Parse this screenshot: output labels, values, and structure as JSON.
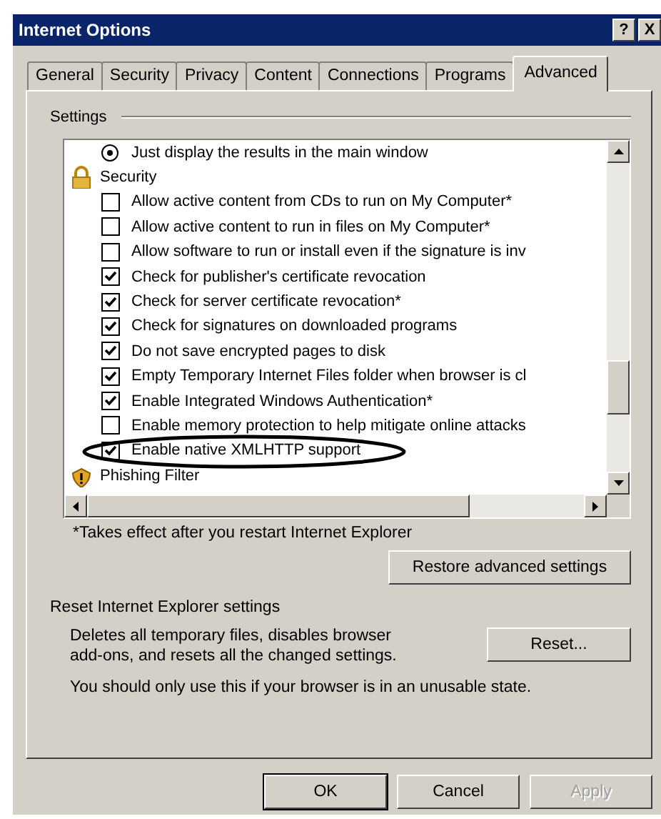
{
  "window": {
    "title": "Internet Options",
    "help_glyph": "?",
    "close_glyph": "X"
  },
  "tabs": [
    {
      "label": "General",
      "selected": false
    },
    {
      "label": "Security",
      "selected": false
    },
    {
      "label": "Privacy",
      "selected": false
    },
    {
      "label": "Content",
      "selected": false
    },
    {
      "label": "Connections",
      "selected": false
    },
    {
      "label": "Programs",
      "selected": false
    },
    {
      "label": "Advanced",
      "selected": true
    }
  ],
  "settings": {
    "label": "Settings",
    "items": [
      {
        "kind": "radio",
        "label": "Just display the results in the main window",
        "checked": true,
        "annotated": false
      },
      {
        "kind": "lock_category",
        "label": "Security"
      },
      {
        "kind": "checkbox",
        "label": "Allow active content from CDs to run on My Computer*",
        "checked": false,
        "annotated": false
      },
      {
        "kind": "checkbox",
        "label": "Allow active content to run in files on My Computer*",
        "checked": false,
        "annotated": false
      },
      {
        "kind": "checkbox",
        "label": "Allow software to run or install even if the signature is inv",
        "checked": false,
        "annotated": false
      },
      {
        "kind": "checkbox",
        "label": "Check for publisher's certificate revocation",
        "checked": true,
        "annotated": false
      },
      {
        "kind": "checkbox",
        "label": "Check for server certificate revocation*",
        "checked": true,
        "annotated": false
      },
      {
        "kind": "checkbox",
        "label": "Check for signatures on downloaded programs",
        "checked": true,
        "annotated": false
      },
      {
        "kind": "checkbox",
        "label": "Do not save encrypted pages to disk",
        "checked": true,
        "annotated": false
      },
      {
        "kind": "checkbox",
        "label": "Empty Temporary Internet Files folder when browser is cl",
        "checked": true,
        "annotated": false
      },
      {
        "kind": "checkbox",
        "label": "Enable Integrated Windows Authentication*",
        "checked": true,
        "annotated": false
      },
      {
        "kind": "checkbox",
        "label": "Enable memory protection to help mitigate online attacks",
        "checked": false,
        "annotated": false
      },
      {
        "kind": "checkbox",
        "label": "Enable native XMLHTTP support",
        "checked": true,
        "annotated": true
      },
      {
        "kind": "warning_category",
        "label": "Phishing Filter"
      }
    ],
    "footnote": "*Takes effect after you restart Internet Explorer",
    "restore_button": "Restore advanced settings"
  },
  "reset": {
    "label": "Reset Internet Explorer settings",
    "description": "Deletes all temporary files, disables browser add-ons, and resets all the changed settings.",
    "button": "Reset...",
    "warning": "You should only use this if your browser is in an unusable state."
  },
  "buttons": [
    {
      "label": "OK",
      "default": true,
      "disabled": false
    },
    {
      "label": "Cancel",
      "default": false,
      "disabled": false
    },
    {
      "label": "Apply",
      "default": false,
      "disabled": true
    }
  ]
}
